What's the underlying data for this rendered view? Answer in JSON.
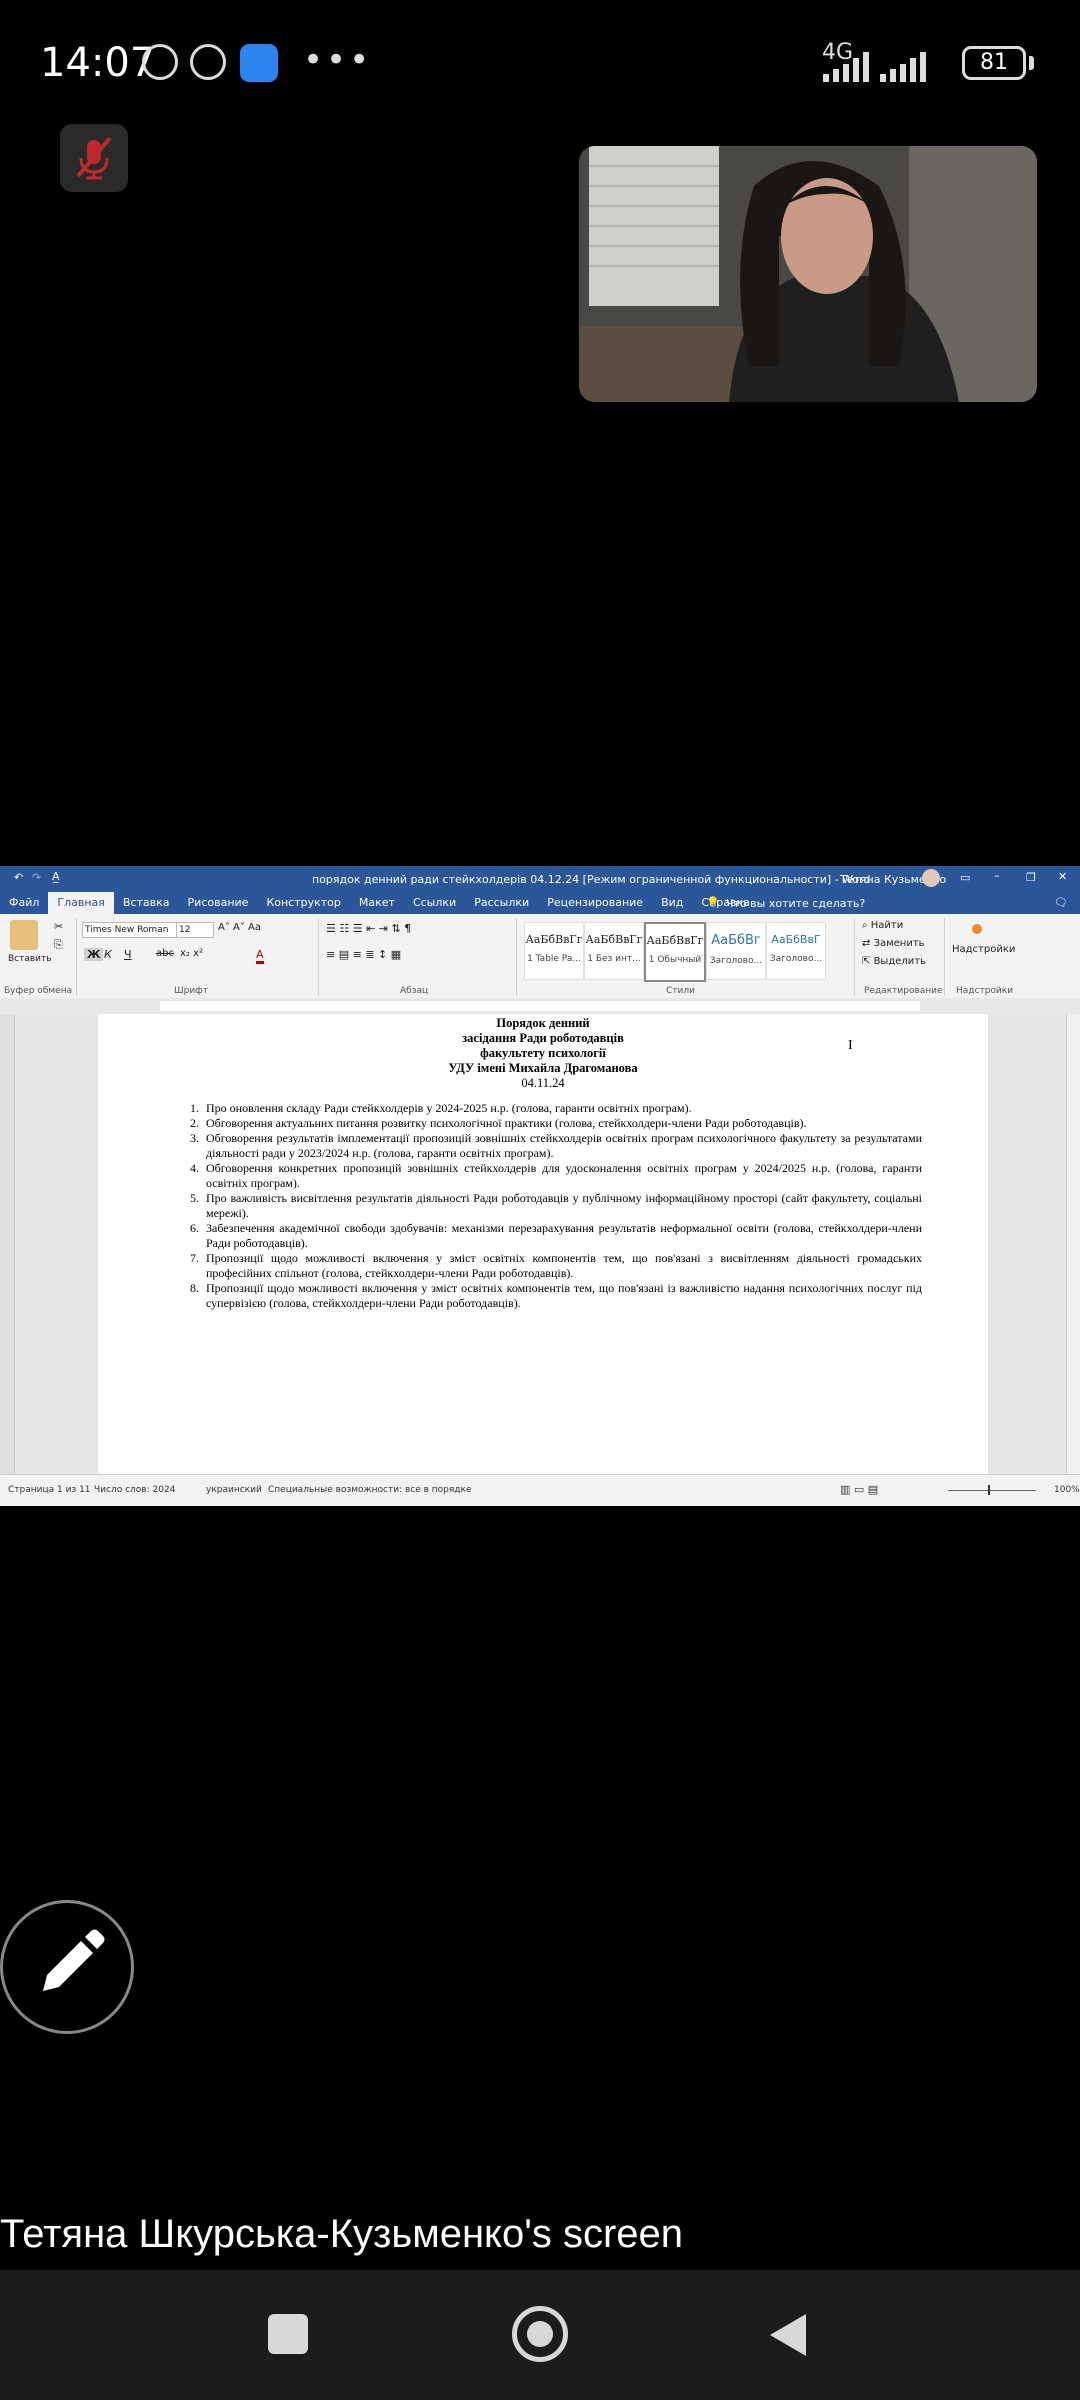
{
  "status_bar": {
    "time": "14:07",
    "network": "4G",
    "battery": "81"
  },
  "word": {
    "title": "порядок денний ради стейкхолдерів 04.12.24 [Режим ограниченной функциональности]  -  Word",
    "user": "Тетяна Кузьменко",
    "tabs": [
      "Файл",
      "Главная",
      "Вставка",
      "Рисование",
      "Конструктор",
      "Макет",
      "Ссылки",
      "Рассылки",
      "Рецензирование",
      "Вид",
      "Справка"
    ],
    "tell_me": "Что вы хотите сделать?",
    "ribbon": {
      "paste_label": "Вставить",
      "font_name": "Times New Roman",
      "font_size": "12",
      "groups": {
        "clipboard": "Буфер обмена",
        "font": "Шрифт",
        "paragraph": "Абзац",
        "styles": "Стили",
        "editing": "Редактирование",
        "addins": "Надстройки"
      },
      "styles": [
        {
          "sample": "АаБбВвГг",
          "name": "1 Table Pa..."
        },
        {
          "sample": "АаБбВвГг",
          "name": "1 Без инт..."
        },
        {
          "sample": "АаБбВвГг",
          "name": "1 Обычный"
        },
        {
          "sample": "АаБбВг",
          "name": "Заголово..."
        },
        {
          "sample": "АаБбВвГ",
          "name": "Заголово..."
        }
      ],
      "find": "Найти",
      "replace": "Заменить",
      "select": "Выделить",
      "addins_button": "Надстройки"
    },
    "document": {
      "heading_lines": [
        "Порядок денний",
        "засідання Ради роботодавців",
        "факультету психології",
        "УДУ імені Михайла Драгоманова",
        "04.11.24"
      ],
      "items": [
        "Про оновлення складу Ради стейкхолдерів у 2024-2025 н.р. (голова, гаранти освітніх програм).",
        "Обговорення актуальних питання розвитку психологічної практики (голова, стейкхолдери-члени Ради роботодавців).",
        "Обговорення результатів імплементації пропозицій зовнішніх стейкхолдерів освітніх програм психологічного факультету за результатами діяльності ради у 2023/2024 н.р. (голова, гаранти освітніх програм).",
        "Обговорення конкретних пропозицій зовнішніх стейкхолдерів для удосконалення освітніх програм у 2024/2025 н.р. (голова, гаранти освітніх програм).",
        "Про важливість висвітлення результатів діяльності Ради роботодавців у публічному інформаційному просторі (сайт факультету, соціальні мережі).",
        "Забезпечення академічної свободи здобувачів: механізми перезарахування результатів неформальної освіти (голова, стейкхолдери-члени Ради роботодавців).",
        "Пропозиції щодо можливості включення у зміст освітніх компонентів тем, що пов'язані з висвітленням діяльності громадських професійних спільнот (голова, стейкхолдери-члени Ради роботодавців).",
        "Пропозиції щодо можливості включення у зміст освітніх компонентів тем, що пов'язані із важливістю надання психологічних послуг під супервізією (голова, стейкхолдери-члени Ради роботодавців)."
      ]
    },
    "status": {
      "page": "Страница 1 из 11",
      "words": "Число слов: 2024",
      "language": "украинский",
      "accessibility": "Специальные возможности: все в порядке",
      "zoom": "100%"
    }
  },
  "screen_caption": "Тетяна Шкурська-Кузьменко's screen"
}
